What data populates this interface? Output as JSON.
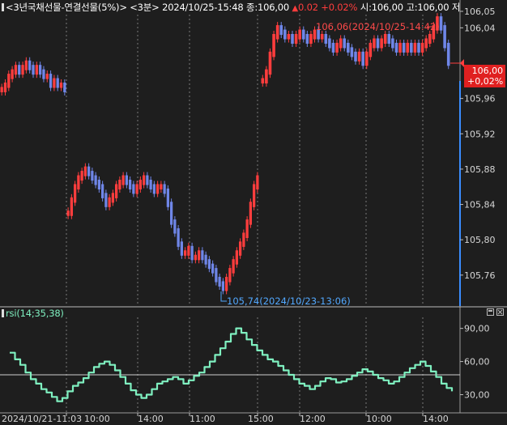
{
  "header": {
    "symbol": "<3년국채선물-연결선물(5%)>",
    "interval": "<3분>",
    "datetime": "2024/10/25-15:48",
    "close_label": "종:",
    "close_value": "106,00",
    "change_arrow": "▲",
    "change_value": "0.02",
    "change_pct": "+0.02%",
    "open_label": "시:",
    "open_value": "106,00",
    "high_label": "고:",
    "high_value": "106,00",
    "low_label": "저"
  },
  "indicator": {
    "name": "rsi(14;35,38)"
  },
  "price_badge": {
    "price": "106,00",
    "change": "+0,02%"
  },
  "colors": {
    "up": "#ff3d3d",
    "down": "#6f86e8",
    "rsi": "#7ff0c0",
    "background": "#1e1e1e",
    "grid": "#7a7a7a",
    "high_label": "#ff4a4a",
    "low_label": "#52a8ff",
    "volume_bar": "#3a8cff"
  },
  "icons": [
    "maximize-icon",
    "close-icon"
  ],
  "chart_data": [
    {
      "type": "candlestick",
      "title": "<3년국채선물-연결선물(5%)>",
      "y_ticks": [
        "106,05",
        "106,04",
        "105,96",
        "105,92",
        "105,88",
        "105,84",
        "105,80",
        "105,76"
      ],
      "ylim": [
        105.725,
        106.055
      ],
      "annotations": {
        "high": "106,06(2024/10/25-14:42)",
        "low": "105,74(2024/10/23-13:06)"
      },
      "current_price": 106.0,
      "series": [
        {
          "name": "s1",
          "values": [
            105.97,
            105.975,
            105.985,
            105.99,
            105.995,
            105.99,
            105.995,
            106.0,
            105.995,
            105.99,
            105.995,
            105.99,
            105.985,
            105.985,
            105.975,
            105.98,
            105.975,
            105.975,
            105.97
          ]
        },
        {
          "name": "s2",
          "values": [
            105.83,
            105.845,
            105.86,
            105.87,
            105.875,
            105.88,
            105.875,
            105.87,
            105.865,
            105.86,
            105.85,
            105.84,
            105.845,
            105.85,
            105.86,
            105.865,
            105.87,
            105.865,
            105.86,
            105.855,
            105.86,
            105.865,
            105.87,
            105.865,
            105.86,
            105.855,
            105.86,
            105.86,
            105.855,
            105.84,
            105.82,
            105.81,
            105.795,
            105.785,
            105.785,
            105.79,
            105.78,
            105.78,
            105.785,
            105.78,
            105.775,
            105.77,
            105.765,
            105.755,
            105.75,
            105.745,
            105.755,
            105.765,
            105.775,
            105.785,
            105.795,
            105.805,
            105.82,
            105.84,
            105.86,
            105.87
          ]
        },
        {
          "name": "s3",
          "values": [
            105.98,
            105.99,
            106.01,
            106.03,
            106.04,
            106.035,
            106.03,
            106.03,
            106.025,
            106.03,
            106.035,
            106.03,
            106.025,
            106.03,
            106.035,
            106.03,
            106.03,
            106.025,
            106.02,
            106.015,
            106.02,
            106.025,
            106.02,
            106.015,
            106.01,
            106.005,
            106.01,
            106.0,
            106.01,
            106.02,
            106.025,
            106.02,
            106.025,
            106.03,
            106.025,
            106.02,
            106.015,
            106.02,
            106.015,
            106.02,
            106.015,
            106.02,
            106.015,
            106.02,
            106.025,
            106.03,
            106.04,
            106.05,
            106.04,
            106.02,
            106.0
          ]
        }
      ]
    },
    {
      "type": "line",
      "title": "rsi(14;35,38)",
      "y_ticks": [
        "90,00",
        "60,00",
        "30,00"
      ],
      "ylim": [
        15,
        100
      ],
      "reference_line": 48,
      "x_ticks": [
        "2024/10/21-11:03",
        "10:00",
        "14:00",
        "11:00",
        "15:00",
        "12:00",
        "10:00",
        "14:00"
      ],
      "series": [
        {
          "name": "rsi",
          "values": [
            68,
            62,
            57,
            50,
            44,
            40,
            35,
            32,
            28,
            24,
            27,
            33,
            38,
            41,
            45,
            50,
            55,
            58,
            60,
            57,
            52,
            46,
            40,
            34,
            30,
            27,
            30,
            35,
            40,
            42,
            44,
            46,
            44,
            40,
            43,
            47,
            50,
            55,
            60,
            66,
            72,
            78,
            85,
            90,
            86,
            80,
            75,
            70,
            66,
            62,
            60,
            56,
            52,
            48,
            44,
            40,
            38,
            35,
            38,
            42,
            45,
            44,
            41,
            42,
            44,
            47,
            50,
            53,
            51,
            48,
            45,
            43,
            40,
            42,
            46,
            50,
            54,
            57,
            60,
            56,
            51,
            46,
            40,
            36,
            33
          ]
        }
      ]
    }
  ]
}
